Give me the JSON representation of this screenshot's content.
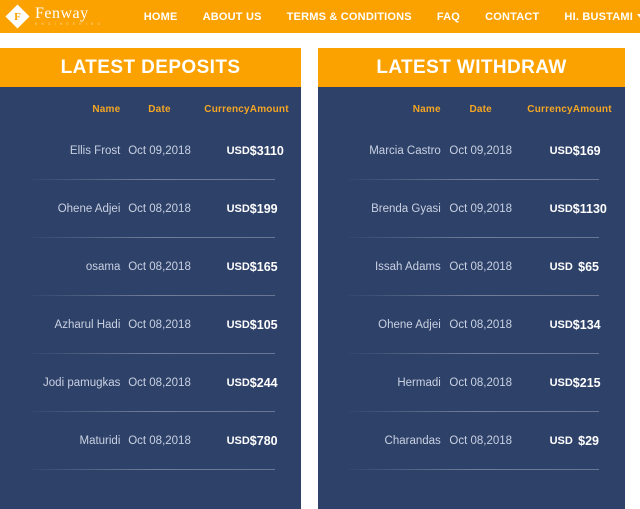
{
  "navbar": {
    "brand": {
      "name": "Fenway",
      "subtitle": "E N G I N E E R I N G",
      "logo_letter": "F"
    },
    "links": [
      {
        "label": "HOME"
      },
      {
        "label": "ABOUT US"
      },
      {
        "label": "TERMS & CONDITIONS"
      },
      {
        "label": "FAQ"
      },
      {
        "label": "CONTACT"
      },
      {
        "label": "HI. BUSTAMI"
      }
    ],
    "background_color": "#fba200",
    "text_color": "#ffffff"
  },
  "colors": {
    "accent_orange": "#fba200",
    "panel_navy": "#2e4169",
    "header_orange_text": "#f5a623",
    "page_background": "#ffffff"
  },
  "columns": {
    "name": "Name",
    "date": "Date",
    "currency": "Currency",
    "amount": "Amount"
  },
  "deposits": {
    "title": "LATEST DEPOSITS",
    "rows": [
      {
        "name": "Ellis Frost",
        "date": "Oct 09,2018",
        "currency": "USD",
        "amount": "$3110"
      },
      {
        "name": "Ohene Adjei",
        "date": "Oct 08,2018",
        "currency": "USD",
        "amount": "$199"
      },
      {
        "name": "osama",
        "date": "Oct 08,2018",
        "currency": "USD",
        "amount": "$165"
      },
      {
        "name": "Azharul Hadi",
        "date": "Oct 08,2018",
        "currency": "USD",
        "amount": "$105"
      },
      {
        "name": "Jodi pamugkas",
        "date": "Oct 08,2018",
        "currency": "USD",
        "amount": "$244"
      },
      {
        "name": "Maturidi",
        "date": "Oct 08,2018",
        "currency": "USD",
        "amount": "$780"
      }
    ]
  },
  "withdraw": {
    "title": "LATEST WITHDRAW",
    "rows": [
      {
        "name": "Marcia Castro",
        "date": "Oct 09,2018",
        "currency": "USD",
        "amount": "$169"
      },
      {
        "name": "Brenda Gyasi",
        "date": "Oct 09,2018",
        "currency": "USD",
        "amount": "$1130"
      },
      {
        "name": "Issah Adams",
        "date": "Oct 08,2018",
        "currency": "USD",
        "amount": "$65"
      },
      {
        "name": "Ohene Adjei",
        "date": "Oct 08,2018",
        "currency": "USD",
        "amount": "$134"
      },
      {
        "name": "Hermadi",
        "date": "Oct 08,2018",
        "currency": "USD",
        "amount": "$215"
      },
      {
        "name": "Charandas",
        "date": "Oct 08,2018",
        "currency": "USD",
        "amount": "$29"
      }
    ]
  }
}
